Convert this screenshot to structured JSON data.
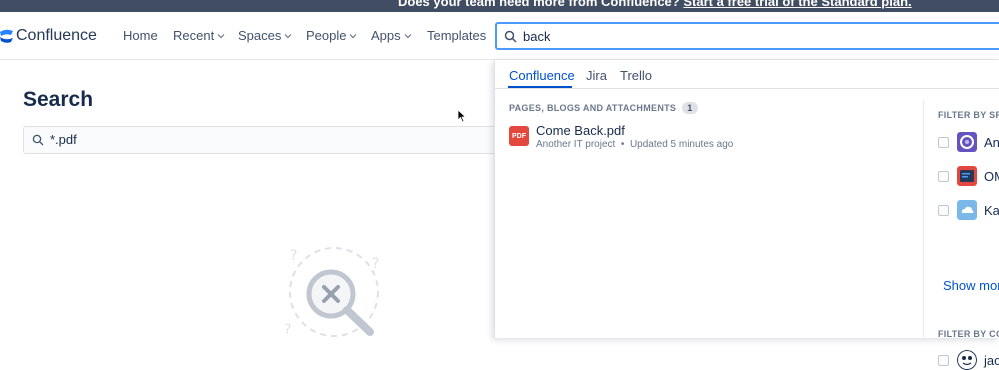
{
  "banner": {
    "text": "Does your team need more from Confluence?",
    "link": "Start a free trial of the Standard plan."
  },
  "nav": {
    "brand": "Confluence",
    "items": [
      "Home",
      "Recent",
      "Spaces",
      "People",
      "Apps",
      "Templates"
    ],
    "search_value": "back"
  },
  "page": {
    "title": "Search",
    "search_value": "*.pdf"
  },
  "dropdown": {
    "tabs": [
      "Confluence",
      "Jira",
      "Trello"
    ],
    "section_label": "PAGES, BLOGS AND ATTACHMENTS",
    "section_count": "1",
    "result": {
      "icon_text": "PDF",
      "title": "Come Back.pdf",
      "space": "Another IT project",
      "separator": "•",
      "updated": "Updated 5 minutes ago"
    },
    "filter_space_head": "FILTER BY SPA",
    "spaces": [
      "An",
      "OM",
      "Ka"
    ],
    "show_more": "Show more",
    "filter_contrib_head": "FILTER BY CO",
    "contributors": [
      "jac"
    ]
  },
  "colors": {
    "accent": "#0052cc",
    "focus": "#4c9aff",
    "pdf": "#e2483d",
    "banner": "#414d62"
  }
}
